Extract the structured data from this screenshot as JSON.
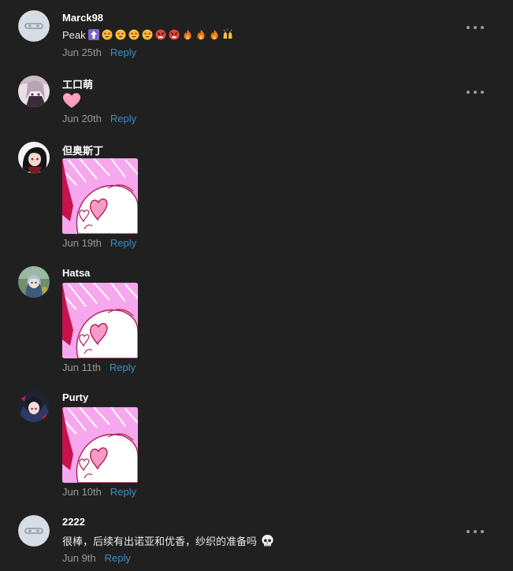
{
  "comments": [
    {
      "username": "Marck98",
      "text": "Peak",
      "emojis": [
        "up-arrow-emoji",
        "star-struck-emoji",
        "star-struck-emoji",
        "star-struck-emoji",
        "star-struck-emoji",
        "rage-emoji",
        "rage-emoji",
        "fire-emoji",
        "fire-emoji",
        "fire-emoji",
        "raised-hands-emoji"
      ],
      "date": "Jun 25th",
      "reply_label": "Reply"
    },
    {
      "username": "工口萌",
      "emojis": [
        "pink-heart-emoji"
      ],
      "date": "Jun 20th",
      "reply_label": "Reply"
    },
    {
      "username": "但奥斯丁",
      "sticker": "heart-hands-sticker",
      "date": "Jun 19th",
      "reply_label": "Reply"
    },
    {
      "username": "Hatsa",
      "sticker": "heart-hands-sticker",
      "date": "Jun 11th",
      "reply_label": "Reply"
    },
    {
      "username": "Purty",
      "sticker": "heart-hands-sticker",
      "date": "Jun 10th",
      "reply_label": "Reply"
    },
    {
      "username": "2222",
      "text": "很棒，后续有出诺亚和优香，纱织的准备吗",
      "emojis": [
        "skull-emoji"
      ],
      "date": "Jun 9th",
      "reply_label": "Reply"
    }
  ],
  "colors": {
    "background": "#202020",
    "reply_link": "#3a8fc9",
    "meta_text": "#9a9a9a",
    "sticker_pink": "#f7a8f0",
    "sticker_crimson": "#c8124d"
  }
}
